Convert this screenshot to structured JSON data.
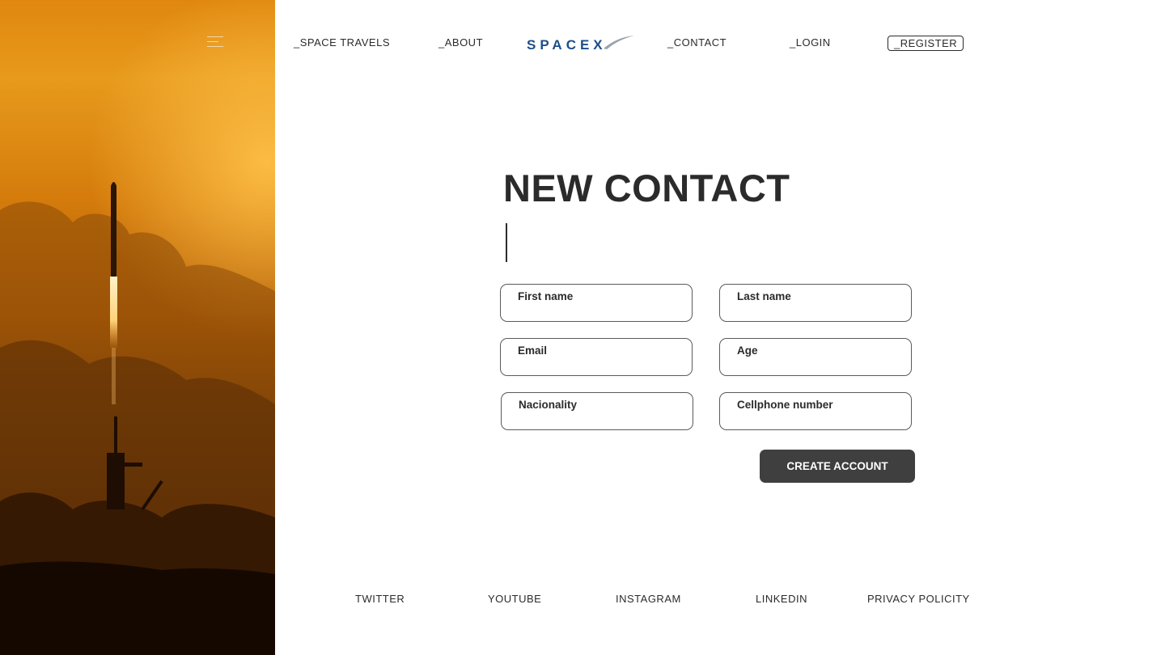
{
  "nav": {
    "menu_icon": "hamburger-menu-icon",
    "links": [
      "_SPACE TRAVELS",
      "_ABOUT",
      "_CONTACT",
      "_LOGIN",
      "_REGISTER"
    ],
    "logo_text": "SPACEX"
  },
  "form": {
    "title": "NEW CONTACT",
    "fields": [
      {
        "label": "First name",
        "value": ""
      },
      {
        "label": "Last name",
        "value": ""
      },
      {
        "label": "Email",
        "value": ""
      },
      {
        "label": "Age",
        "value": ""
      },
      {
        "label": "Nacionality",
        "value": ""
      },
      {
        "label": "Cellphone number",
        "value": ""
      }
    ],
    "submit_label": "CREATE ACCOUNT"
  },
  "footer": {
    "links": [
      "TWITTER",
      "YOUTUBE",
      "INSTAGRAM",
      "LINKEDIN",
      "PRIVACY POLICITY"
    ]
  },
  "colors": {
    "brand_blue": "#1c4f8a",
    "button_bg": "#3f3f3f",
    "hero_orange": "#e0870f"
  }
}
